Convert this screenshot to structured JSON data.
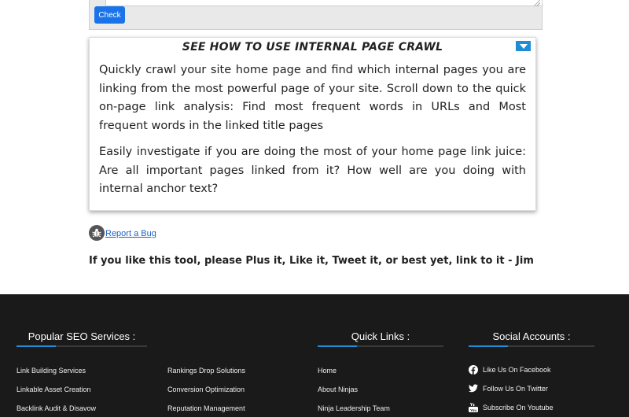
{
  "form": {
    "check_label": "Check"
  },
  "info": {
    "title": "SEE HOW TO USE INTERNAL PAGE CRAWL",
    "paragraph1": "Quickly crawl your site home page and find which internal pages you are linking from the most powerful page of your site. Scroll down to the quick on-page link analysis: Find most frequent words in URLs and Most frequent words in the linked title pages",
    "paragraph2": "Easily investigate if you are doing the most of your home page link juice: Are all important pages linked from it? How well are you doing with internal anchor text?"
  },
  "bug": {
    "label": "Report a Bug"
  },
  "like_line": "If you like this tool, please Plus it, Like it, Tweet it, or best yet, link to it - Jim",
  "footer": {
    "seo": {
      "heading": "Popular SEO Services :",
      "col1": [
        "Link Building Services",
        "Linkable Asset Creation",
        "Backlink Audit & Disavow"
      ],
      "col2": [
        "Rankings Drop Solutions",
        "Conversion Optimization",
        "Reputation Management"
      ]
    },
    "quick": {
      "heading": "Quick Links :",
      "items": [
        "Home",
        "About Ninjas",
        "Ninja Leadership Team"
      ]
    },
    "social": {
      "heading": "Social Accounts :",
      "items": [
        {
          "label": "Like Us On Facebook",
          "icon": "facebook-icon"
        },
        {
          "label": "Follow Us On Twitter",
          "icon": "twitter-icon"
        },
        {
          "label": "Subscribe On Youtube",
          "icon": "youtube-icon"
        }
      ]
    }
  },
  "colors": {
    "accent": "#1f8dd6",
    "button": "#1a73e8",
    "footer_bg": "#1a1a1a",
    "link": "#1a62c9"
  }
}
